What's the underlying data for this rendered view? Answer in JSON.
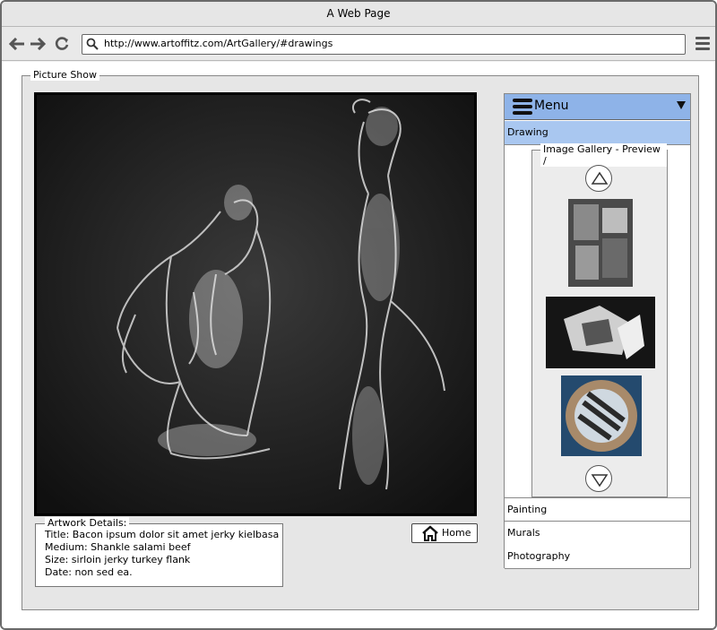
{
  "window": {
    "title": "A Web Page"
  },
  "browser": {
    "url": "http://www.artoffitz.com/ArtGallery/#drawings"
  },
  "picture_show": {
    "legend": "Picture Show",
    "home_label": "Home"
  },
  "details": {
    "legend": "Artwork Details:",
    "title": "Title: Bacon ipsum dolor sit amet jerky kielbasa",
    "medium": "Medium: Shankle salami beef",
    "size": "Size: sirloin jerky turkey flank",
    "date": "Date: non sed ea."
  },
  "menu": {
    "header": "Menu",
    "items": [
      "Drawing",
      "Painting",
      "Murals",
      "Photography"
    ],
    "active_item": "Drawing"
  },
  "gallery": {
    "legend": "Image Gallery - Preview /"
  },
  "colors": {
    "menu_header": "#8eb3e8",
    "menu_active": "#a9c7f0"
  }
}
